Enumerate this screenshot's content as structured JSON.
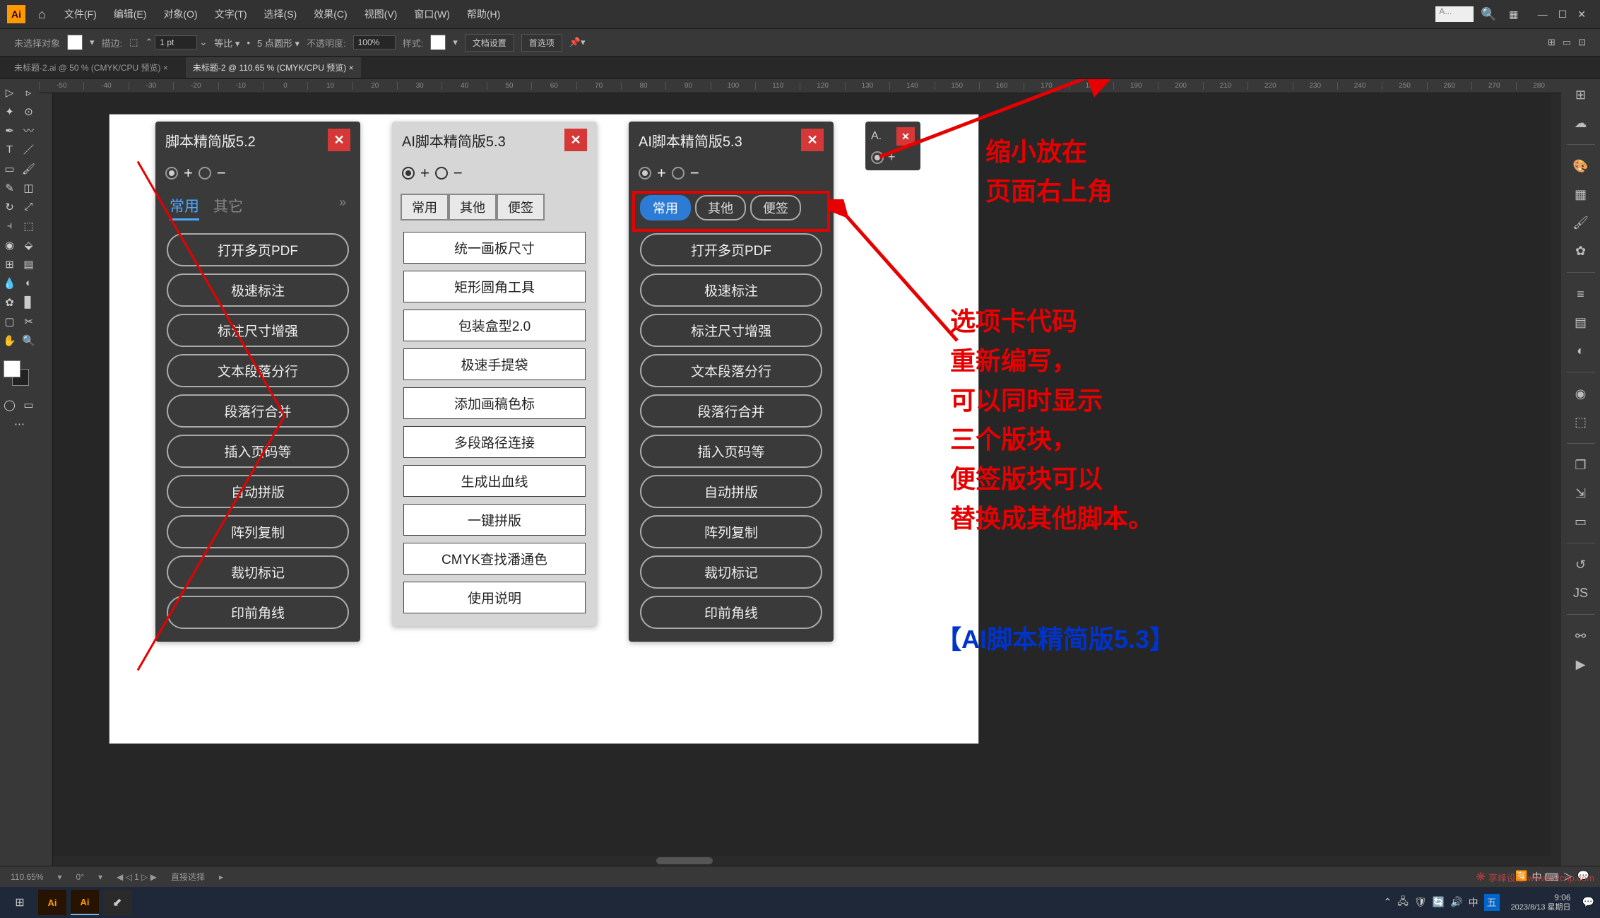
{
  "menu": {
    "items": [
      "文件(F)",
      "编辑(E)",
      "对象(O)",
      "文字(T)",
      "选择(S)",
      "效果(C)",
      "视图(V)",
      "窗口(W)",
      "帮助(H)"
    ],
    "search_placeholder": "A..."
  },
  "control_bar": {
    "no_sel": "未选择对象",
    "stroke_label": "描边:",
    "stroke_value": "1 pt",
    "uniform": "等比",
    "brush": "5 点圆形",
    "opacity_label": "不透明度:",
    "opacity_value": "100%",
    "style_label": "样式:",
    "doc_setup": "文档设置",
    "prefs": "首选项"
  },
  "tabs": {
    "t1": "未标题-2.ai @ 50 % (CMYK/CPU 预览)",
    "t2": "未标题-2 @ 110.65 % (CMYK/CPU 预览)"
  },
  "ruler_ticks": [
    "-50",
    "-40",
    "-30",
    "-20",
    "-10",
    "0",
    "10",
    "20",
    "30",
    "40",
    "50",
    "60",
    "70",
    "80",
    "90",
    "100",
    "110",
    "120",
    "130",
    "140",
    "150",
    "160",
    "170",
    "180",
    "190",
    "200",
    "210",
    "220",
    "230",
    "240",
    "250",
    "260",
    "270",
    "280"
  ],
  "panel52": {
    "title": "脚本精简版5.2",
    "tabs": [
      "常用",
      "其它"
    ],
    "buttons": [
      "打开多页PDF",
      "极速标注",
      "标注尺寸增强",
      "文本段落分行",
      "段落行合并",
      "插入页码等",
      "自动拼版",
      "阵列复制",
      "裁切标记",
      "印前角线"
    ]
  },
  "panel53_light": {
    "title": "AI脚本精简版5.3",
    "tabs": [
      "常用",
      "其他",
      "便签"
    ],
    "buttons": [
      "统一画板尺寸",
      "矩形圆角工具",
      "包装盒型2.0",
      "极速手提袋",
      "添加画稿色标",
      "多段路径连接",
      "生成出血线",
      "一键拼版",
      "CMYK查找潘通色",
      "使用说明"
    ]
  },
  "panel53_dark": {
    "title": "AI脚本精简版5.3",
    "tabs": [
      "常用",
      "其他",
      "便签"
    ],
    "buttons": [
      "打开多页PDF",
      "极速标注",
      "标注尺寸增强",
      "文本段落分行",
      "段落行合并",
      "插入页码等",
      "自动拼版",
      "阵列复制",
      "裁切标记",
      "印前角线"
    ]
  },
  "mini": {
    "title": "A."
  },
  "annotations": {
    "top1": "缩小放在",
    "top2": "页面右上角",
    "body": "选项卡代码\n重新编写，\n可以同时显示\n三个版块，\n便签版块可以\n替换成其他脚本。",
    "title_bracket": "【AI脚本精简版5.3】"
  },
  "status": {
    "zoom": "110.65%",
    "angle": "0°",
    "layer": "1",
    "tool": "直接选择"
  },
  "taskbar": {
    "time": "9:06",
    "date": "2023/8/13 星期日",
    "ime": "中"
  },
  "watermark": "享峰设汇 www.52cnp.com"
}
